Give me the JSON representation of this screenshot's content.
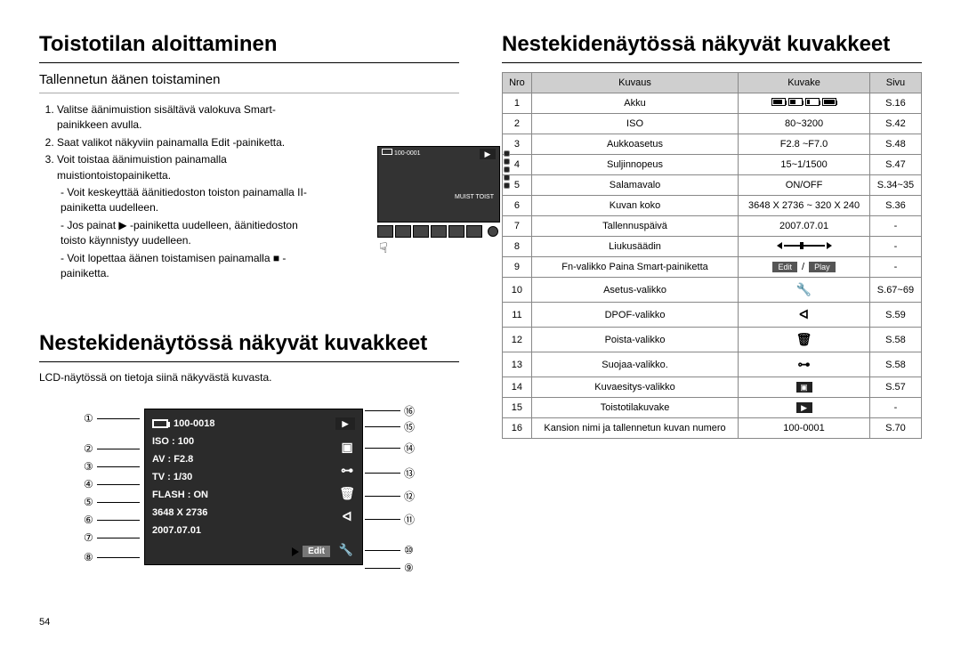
{
  "page_number": "54",
  "left": {
    "h1": "Toistotilan aloittaminen",
    "sub": "Tallennetun äänen toistaminen",
    "steps": [
      "Valitse äänimuistion sisältävä valokuva Smart-painikkeen avulla.",
      "Saat valikot näkyviin painamalla Edit -painiketta.",
      "Voit toistaa äänimuistion painamalla muistiontoistopainiketta."
    ],
    "dashes": [
      "Voit keskeyttää äänitiedoston toiston painamalla II-painiketta uudelleen.",
      "Jos painat ▶ -painiketta uudelleen, äänitiedoston toisto käynnistyy uudelleen.",
      "Voit lopettaa äänen toistamisen painamalla ■ -painiketta."
    ],
    "memo": {
      "folder": "100-0001",
      "label": "MUIST TOIST"
    },
    "h2": "Nestekidenäytössä näkyvät kuvakkeet",
    "desc": "LCD-näytössä on tietoja siinä näkyvästä kuvasta.",
    "lcd": {
      "folder": "100-0018",
      "iso": "ISO : 100",
      "av": "AV : F2.8",
      "tv": "TV : 1/30",
      "flash": "FLASH : ON",
      "size": "3648 X 2736",
      "date": "2007.07.01",
      "edit": "Edit"
    },
    "labels_left": [
      "①",
      "②",
      "③",
      "④",
      "⑤",
      "⑥",
      "⑦",
      "⑧"
    ],
    "labels_right": [
      "⑯",
      "⑮",
      "⑭",
      "⑬",
      "⑫",
      "⑪",
      "⑩",
      "⑨"
    ]
  },
  "right": {
    "h1": "Nestekidenäytössä näkyvät kuvakkeet",
    "head": {
      "n": "Nro",
      "d": "Kuvaus",
      "i": "Kuvake",
      "p": "Sivu"
    },
    "rows": [
      {
        "n": "1",
        "d": "Akku",
        "i": "__BATT__",
        "p": "S.16"
      },
      {
        "n": "2",
        "d": "ISO",
        "i": "80~3200",
        "p": "S.42"
      },
      {
        "n": "3",
        "d": "Aukkoasetus",
        "i": "F2.8 ~F7.0",
        "p": "S.48"
      },
      {
        "n": "4",
        "d": "Suljinnopeus",
        "i": "15~1/1500",
        "p": "S.47"
      },
      {
        "n": "5",
        "d": "Salamavalo",
        "i": "ON/OFF",
        "p": "S.34~35"
      },
      {
        "n": "6",
        "d": "Kuvan koko",
        "i": "3648 X 2736 ~ 320 X 240",
        "p": "S.36"
      },
      {
        "n": "7",
        "d": "Tallennuspäivä",
        "i": "2007.07.01",
        "p": "-"
      },
      {
        "n": "8",
        "d": "Liukusäädin",
        "i": "__SLIDER__",
        "p": "-"
      },
      {
        "n": "9",
        "d": "Fn-valikko Paina Smart-painiketta",
        "i": "__EDITPLAY__",
        "p": "-"
      },
      {
        "n": "10",
        "d": "Asetus-valikko",
        "i": "__WRENCH__",
        "p": "S.67~69"
      },
      {
        "n": "11",
        "d": "DPOF-valikko",
        "i": "__DPOF__",
        "p": "S.59"
      },
      {
        "n": "12",
        "d": "Poista-valikko",
        "i": "__TRASH__",
        "p": "S.58"
      },
      {
        "n": "13",
        "d": "Suojaa-valikko.",
        "i": "__LOCK__",
        "p": "S.58"
      },
      {
        "n": "14",
        "d": "Kuvaesitys-valikko",
        "i": "__SLIDE__",
        "p": "S.57"
      },
      {
        "n": "15",
        "d": "Toistotilakuvake",
        "i": "__PLAY__",
        "p": "-"
      },
      {
        "n": "16",
        "d": "Kansion nimi ja tallennetun kuvan numero",
        "i": "100-0001",
        "p": "S.70"
      }
    ]
  }
}
